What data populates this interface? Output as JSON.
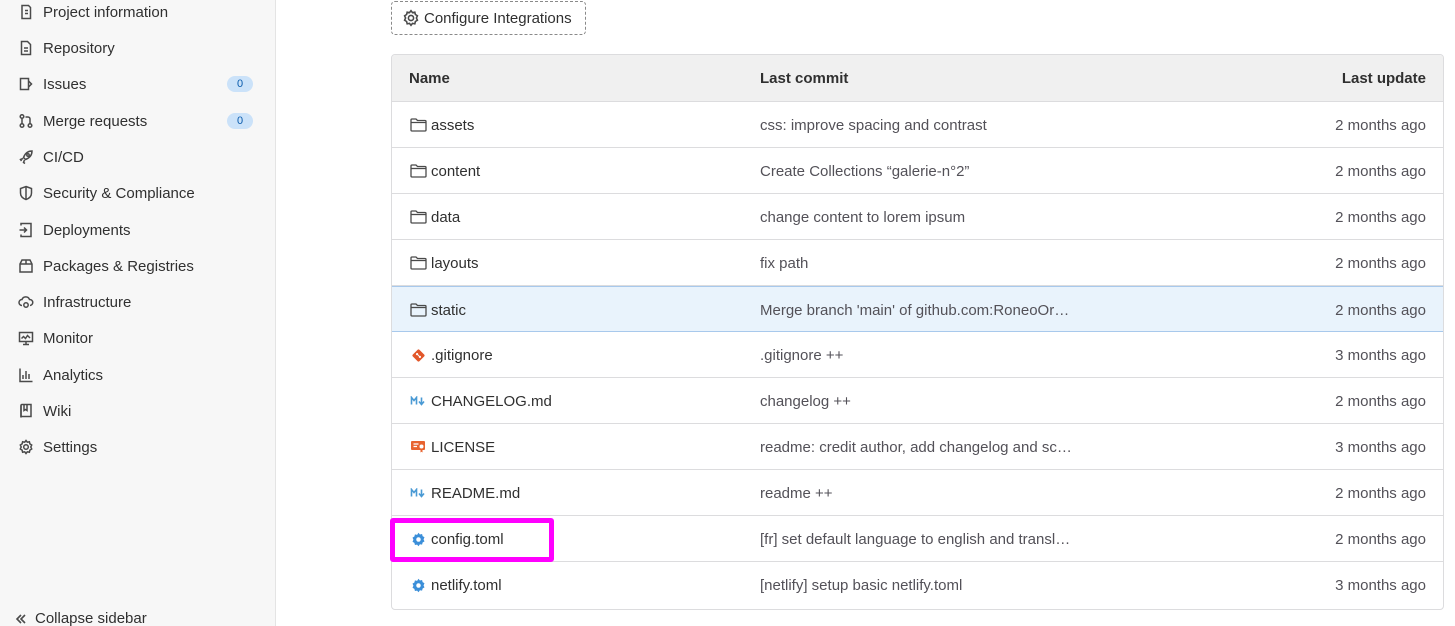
{
  "sidebar": {
    "items": [
      {
        "label": "Project information",
        "icon": "project-info-icon",
        "badge": ""
      },
      {
        "label": "Repository",
        "icon": "document-icon",
        "badge": ""
      },
      {
        "label": "Issues",
        "icon": "issues-icon",
        "badge": "0"
      },
      {
        "label": "Merge requests",
        "icon": "merge-request-icon",
        "badge": "0"
      },
      {
        "label": "CI/CD",
        "icon": "rocket-icon",
        "badge": ""
      },
      {
        "label": "Security & Compliance",
        "icon": "shield-icon",
        "badge": ""
      },
      {
        "label": "Deployments",
        "icon": "deployments-icon",
        "badge": ""
      },
      {
        "label": "Packages & Registries",
        "icon": "package-icon",
        "badge": ""
      },
      {
        "label": "Infrastructure",
        "icon": "cloud-gear-icon",
        "badge": ""
      },
      {
        "label": "Monitor",
        "icon": "monitor-icon",
        "badge": ""
      },
      {
        "label": "Analytics",
        "icon": "chart-icon",
        "badge": ""
      },
      {
        "label": "Wiki",
        "icon": "book-icon",
        "badge": ""
      },
      {
        "label": "Settings",
        "icon": "gear-icon",
        "badge": ""
      }
    ],
    "collapse_label": "Collapse sidebar"
  },
  "configure_label": "Configure Integrations",
  "table": {
    "headers": {
      "name": "Name",
      "commit": "Last commit",
      "update": "Last update"
    },
    "rows": [
      {
        "name": "assets",
        "type": "folder",
        "commit": "css: improve spacing and contrast",
        "date": "2 months ago"
      },
      {
        "name": "content",
        "type": "folder",
        "commit": "Create Collections “galerie-n°2”",
        "date": "2 months ago"
      },
      {
        "name": "data",
        "type": "folder",
        "commit": "change content to lorem ipsum",
        "date": "2 months ago"
      },
      {
        "name": "layouts",
        "type": "folder",
        "commit": "fix path",
        "date": "2 months ago"
      },
      {
        "name": "static",
        "type": "folder",
        "commit": "Merge branch 'main' of github.com:RoneoOr…",
        "date": "2 months ago"
      },
      {
        "name": ".gitignore",
        "type": "git",
        "commit": ".gitignore ++",
        "date": "3 months ago"
      },
      {
        "name": "CHANGELOG.md",
        "type": "markdown",
        "commit": "changelog ++",
        "date": "2 months ago"
      },
      {
        "name": "LICENSE",
        "type": "license",
        "commit": "readme: credit author, add changelog and sc…",
        "date": "3 months ago"
      },
      {
        "name": "README.md",
        "type": "markdown",
        "commit": "readme ++",
        "date": "2 months ago"
      },
      {
        "name": "config.toml",
        "type": "config",
        "commit": "[fr] set default language to english and transl…",
        "date": "2 months ago"
      },
      {
        "name": "netlify.toml",
        "type": "config",
        "commit": "[netlify] setup basic netlify.toml",
        "date": "3 months ago"
      }
    ]
  },
  "colors": {
    "highlight": "#ff00ff",
    "badge_bg": "#cbe2f9",
    "selected_row": "#e9f3fc",
    "git_icon": "#e2572a",
    "config_icon": "#3b8fd9",
    "markdown_icon": "#4a9ad4",
    "license_icon": "#e8632f"
  }
}
